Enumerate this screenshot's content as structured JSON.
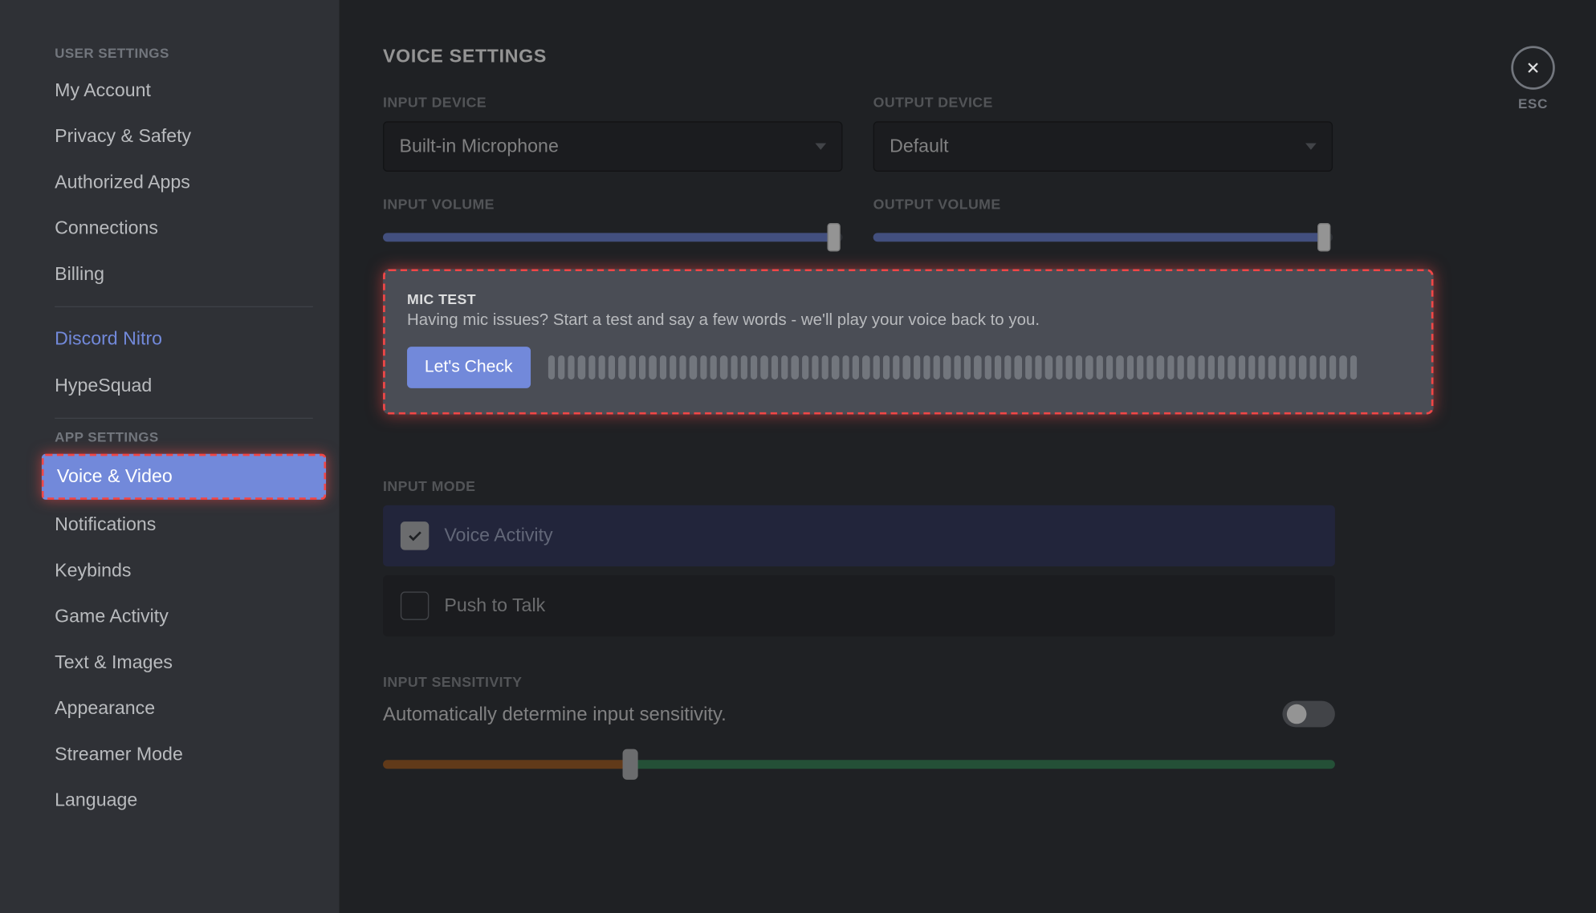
{
  "sidebar": {
    "header1": "USER SETTINGS",
    "user_items": [
      "My Account",
      "Privacy & Safety",
      "Authorized Apps",
      "Connections",
      "Billing"
    ],
    "nitro": "Discord Nitro",
    "hypesquad": "HypeSquad",
    "header2": "APP SETTINGS",
    "app_items": [
      "Voice & Video",
      "Notifications",
      "Keybinds",
      "Game Activity",
      "Text & Images",
      "Appearance",
      "Streamer Mode",
      "Language"
    ],
    "active_app_index": 0
  },
  "main": {
    "title": "VOICE SETTINGS",
    "input_device_label": "INPUT DEVICE",
    "input_device_value": "Built-in Microphone",
    "output_device_label": "OUTPUT DEVICE",
    "output_device_value": "Default",
    "input_volume_label": "INPUT VOLUME",
    "input_volume_pct": 98,
    "output_volume_label": "OUTPUT VOLUME",
    "output_volume_pct": 98,
    "mic_test": {
      "label": "MIC TEST",
      "desc": "Having mic issues? Start a test and say a few words - we'll play your voice back to you.",
      "button": "Let's Check",
      "vu_bars": 80
    },
    "input_mode_label": "INPUT MODE",
    "input_modes": [
      {
        "label": "Voice Activity",
        "selected": true
      },
      {
        "label": "Push to Talk",
        "selected": false
      }
    ],
    "input_sensitivity_label": "INPUT SENSITIVITY",
    "input_sensitivity_desc": "Automatically determine input sensitivity.",
    "sensitivity_auto": false,
    "sensitivity_split_pct": 26
  },
  "close": {
    "esc": "ESC"
  }
}
